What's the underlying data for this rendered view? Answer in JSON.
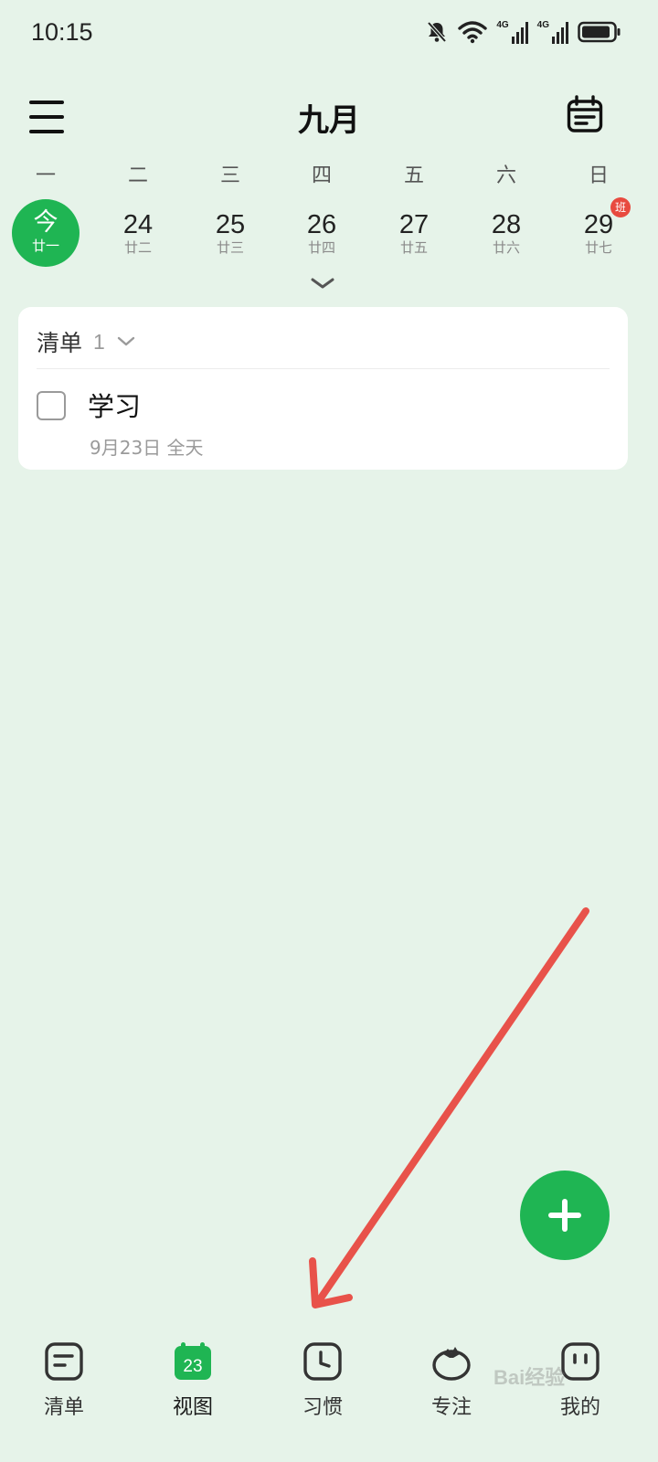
{
  "status_bar": {
    "time": "10:15",
    "network_1": "4G",
    "network_2": "4G"
  },
  "header": {
    "title": "九月"
  },
  "weekdays": [
    "一",
    "二",
    "三",
    "四",
    "五",
    "六",
    "日"
  ],
  "dates": [
    {
      "num": "今",
      "lunar": "廿一",
      "today": true
    },
    {
      "num": "24",
      "lunar": "廿二"
    },
    {
      "num": "25",
      "lunar": "廿三"
    },
    {
      "num": "26",
      "lunar": "廿四"
    },
    {
      "num": "27",
      "lunar": "廿五"
    },
    {
      "num": "28",
      "lunar": "廿六"
    },
    {
      "num": "29",
      "lunar": "廿七",
      "badge": "班"
    }
  ],
  "card": {
    "list_label": "清单",
    "list_count": "1",
    "task": {
      "title": "学习",
      "date": "9月23日 全天"
    }
  },
  "nav": {
    "items": [
      {
        "label": "清单",
        "icon": "list-icon"
      },
      {
        "label": "视图",
        "icon": "calendar-view-icon",
        "active": true,
        "badge_num": "23"
      },
      {
        "label": "习惯",
        "icon": "clock-icon"
      },
      {
        "label": "专注",
        "icon": "tomato-icon"
      },
      {
        "label": "我的",
        "icon": "profile-icon"
      }
    ]
  },
  "watermark": "Bai经验",
  "colors": {
    "accent": "#1fb553",
    "background": "#e6f3e9",
    "badge": "#e84a3f",
    "arrow": "#e8524a"
  }
}
